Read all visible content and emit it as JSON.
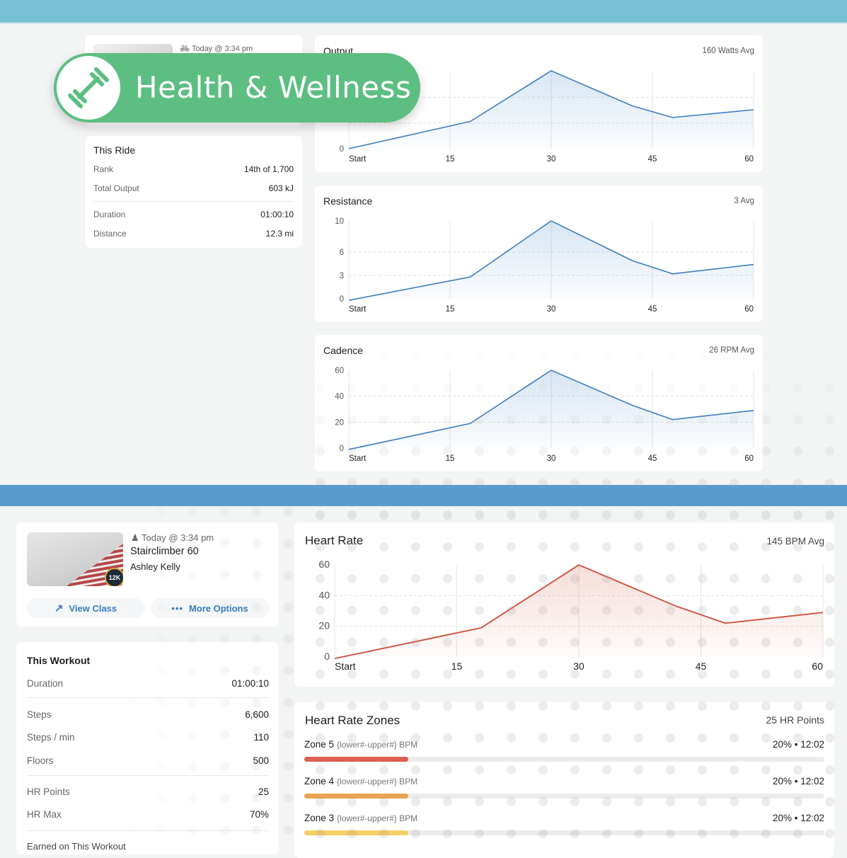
{
  "badge": {
    "label": "Health & Wellness",
    "icon": "dumbbell-icon",
    "color": "#5dbe82"
  },
  "ride": {
    "timestamp": "Today @ 3:34 pm",
    "timestamp_icon": "bike-icon",
    "stats_title": "This Ride",
    "stats": [
      {
        "label": "Rank",
        "value": "14th of 1,700"
      },
      {
        "label": "Total Output",
        "value": "603 kJ"
      },
      {
        "label": "Duration",
        "value": "01:00:10"
      },
      {
        "label": "Distance",
        "value": "12.3 mi"
      }
    ]
  },
  "workout": {
    "timestamp": "Today @ 3:34 pm",
    "timestamp_icon": "stairclimber-icon",
    "class_name": "Stairclimber 60",
    "instructor": "Ashley Kelly",
    "milestone_badge": "12K",
    "view_class_label": "View Class",
    "more_options_label": "More Options",
    "stats_title": "This Workout",
    "stats": [
      {
        "label": "Duration",
        "value": "01:00:10"
      },
      {
        "label": "Steps",
        "value": "6,600"
      },
      {
        "label": "Steps / min",
        "value": "110"
      },
      {
        "label": "Floors",
        "value": "500"
      },
      {
        "label": "HR Points",
        "value": "25"
      },
      {
        "label": "HR Max",
        "value": "70%"
      }
    ],
    "earned_title": "Earned on This Workout"
  },
  "zones": {
    "title": "Heart Rate Zones",
    "points": "25 HR Points",
    "items": [
      {
        "name": "Zone 5",
        "range": "{lower#-upper#} BPM",
        "value": "20% • 12:02",
        "percent": 20,
        "color": "#dc5f50"
      },
      {
        "name": "Zone 4",
        "range": "{lower#-upper#} BPM",
        "value": "20% • 12:02",
        "percent": 20,
        "color": "#e8a452"
      },
      {
        "name": "Zone 3",
        "range": "{lower#-upper#} BPM",
        "value": "20% • 12:02",
        "percent": 20,
        "color": "#f2d062"
      }
    ]
  },
  "chart_data": [
    {
      "id": "output",
      "type": "area",
      "title": "Output",
      "avg": "160 Watts Avg",
      "x": [
        0,
        18,
        30,
        42,
        48,
        60
      ],
      "y": [
        0,
        35,
        100,
        55,
        40,
        50
      ],
      "xticks": [
        "Start",
        "15",
        "30",
        "45",
        "60"
      ],
      "xtick_values": [
        0,
        15,
        30,
        45,
        60
      ],
      "yticks": [
        "0"
      ],
      "ytick_values": [
        0
      ],
      "ylim": [
        0,
        100
      ],
      "xlim": [
        0,
        60
      ],
      "color": "#3d7fc1",
      "grid": true
    },
    {
      "id": "resistance",
      "type": "area",
      "title": "Resistance",
      "avg": "3 Avg",
      "x": [
        0,
        18,
        30,
        42,
        48,
        60
      ],
      "y": [
        -0.2,
        2.8,
        10,
        4.9,
        3.2,
        4.4
      ],
      "xticks": [
        "Start",
        "15",
        "30",
        "45",
        "60"
      ],
      "xtick_values": [
        0,
        15,
        30,
        45,
        60
      ],
      "yticks": [
        "0",
        "3",
        "6",
        "10"
      ],
      "ytick_values": [
        0,
        3,
        6,
        10
      ],
      "ylim": [
        0,
        10
      ],
      "xlim": [
        0,
        60
      ],
      "color": "#3d7fc1",
      "grid": true
    },
    {
      "id": "cadence",
      "type": "area",
      "title": "Cadence",
      "avg": "26 RPM Avg",
      "x": [
        0,
        18,
        30,
        42,
        48,
        60
      ],
      "y": [
        -1,
        19,
        60,
        33,
        22,
        29
      ],
      "xticks": [
        "Start",
        "15",
        "30",
        "45",
        "60"
      ],
      "xtick_values": [
        0,
        15,
        30,
        45,
        60
      ],
      "yticks": [
        "0",
        "20",
        "40",
        "60"
      ],
      "ytick_values": [
        0,
        20,
        40,
        60
      ],
      "ylim": [
        0,
        60
      ],
      "xlim": [
        0,
        60
      ],
      "color": "#3d7fc1",
      "grid": true
    },
    {
      "id": "heartrate",
      "type": "area",
      "title": "Heart Rate",
      "avg": "145 BPM Avg",
      "x": [
        0,
        18,
        30,
        42,
        48,
        60
      ],
      "y": [
        -1,
        19,
        60,
        33,
        22,
        29
      ],
      "xticks": [
        "Start",
        "15",
        "30",
        "45",
        "60"
      ],
      "xtick_values": [
        0,
        15,
        30,
        45,
        60
      ],
      "yticks": [
        "0",
        "20",
        "40",
        "60"
      ],
      "ytick_values": [
        0,
        20,
        40,
        60
      ],
      "ylim": [
        0,
        60
      ],
      "xlim": [
        0,
        60
      ],
      "color": "#cf5a45",
      "grid": true
    }
  ]
}
